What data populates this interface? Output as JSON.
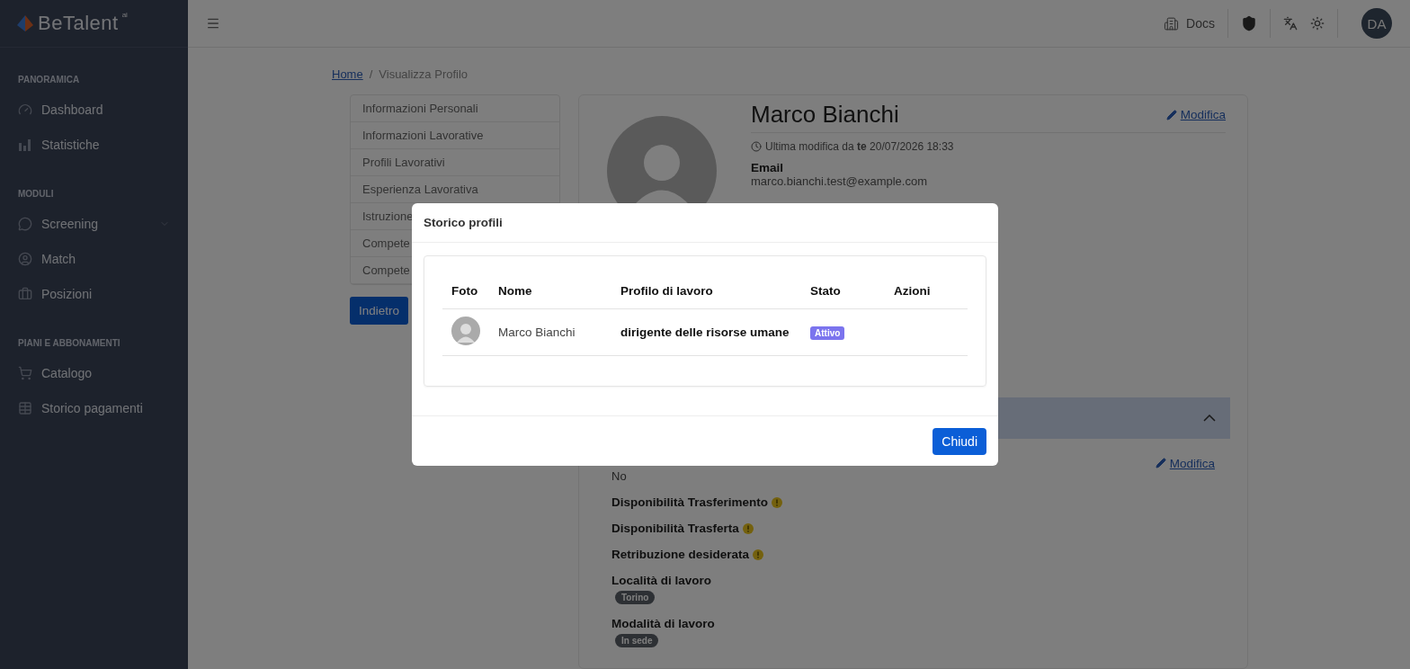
{
  "brand": {
    "name": "BeTalent",
    "suffix": "ai"
  },
  "sidebar": {
    "sections": [
      {
        "title": "PANORAMICA",
        "items": [
          {
            "label": "Dashboard",
            "kind": "link"
          },
          {
            "label": "Statistiche",
            "kind": "link"
          }
        ]
      },
      {
        "title": "MODULI",
        "items": [
          {
            "label": "Screening",
            "kind": "group",
            "expanded": false
          },
          {
            "label": "Match",
            "kind": "link"
          },
          {
            "label": "Posizioni",
            "kind": "link"
          }
        ]
      },
      {
        "title": "PIANI E ABBONAMENTI",
        "items": [
          {
            "label": "Catalogo",
            "kind": "link"
          },
          {
            "label": "Storico pagamenti",
            "kind": "link"
          }
        ]
      }
    ]
  },
  "topbar": {
    "docs": "Docs",
    "avatar": "DA"
  },
  "breadcrumb": [
    {
      "label": "Home",
      "kind": "link"
    },
    {
      "label": "/",
      "kind": "separator"
    },
    {
      "label": "Visualizza Profilo",
      "kind": "current"
    }
  ],
  "profile_nav": [
    "Informazioni Personali",
    "Informazioni Lavorative",
    "Profili Lavorativi",
    "Esperienza Lavorativa",
    "Istruzione",
    "Compete",
    "Compete"
  ],
  "back_button": "Indietro",
  "profile": {
    "name": "Marco Bianchi",
    "edit": "Modifica",
    "last_modified": "Ultima modifica da **te** 20/07/2026 18:33",
    "email_label": "Email",
    "email": "marco.bianchi.test@example.com"
  },
  "section": {
    "expanded": true,
    "edit": "Modifica",
    "fields": [
      {
        "kind": "value",
        "value": "No"
      },
      {
        "kind": "warning",
        "label": "Disponibilità Trasferimento"
      },
      {
        "kind": "warning",
        "label": "Disponibilità Trasferta"
      },
      {
        "kind": "warning",
        "label": "Retribuzione desiderata"
      },
      {
        "kind": "tags",
        "label": "Località di lavoro",
        "tags": [
          "Torino"
        ]
      },
      {
        "kind": "tags",
        "label": "Modalità di lavoro",
        "tags": [
          "In sede"
        ]
      }
    ]
  },
  "modal": {
    "title": "Storico profili",
    "columns": [
      "Foto",
      "Nome",
      "Profilo di lavoro",
      "Stato",
      "Azioni"
    ],
    "rows": [
      {
        "name": "Marco Bianchi",
        "job_profile": "dirigente delle risorse umane",
        "status": "Attivo"
      }
    ],
    "close": "Chiudi"
  }
}
